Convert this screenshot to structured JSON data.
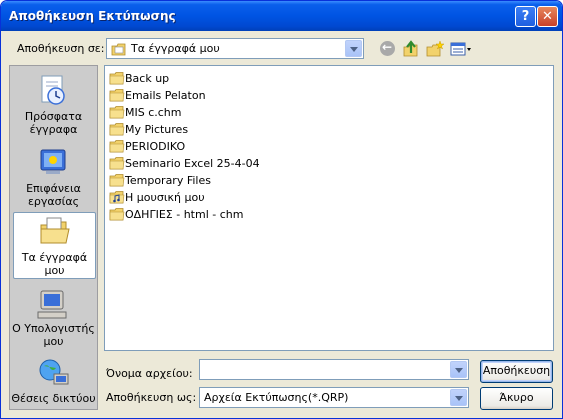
{
  "window": {
    "title": "Αποθήκευση Εκτύπωσης"
  },
  "titlebar": {
    "help_label": "?",
    "close_label": "✕"
  },
  "look_in": {
    "label": "Αποθήκευση σε:",
    "value": "Τα έγγραφά μου"
  },
  "toolbar": {
    "icons": [
      "back-icon",
      "up-folder-icon",
      "new-folder-icon",
      "view-menu-icon"
    ]
  },
  "places": [
    {
      "label": "Πρόσφατα έγγραφα",
      "icon": "recent-documents-icon"
    },
    {
      "label": "Επιφάνεια εργασίας",
      "icon": "desktop-icon"
    },
    {
      "label": "Τα έγγραφά μου",
      "icon": "my-documents-icon",
      "selected": true
    },
    {
      "label": "Ο Υπολογιστής μου",
      "icon": "my-computer-icon"
    },
    {
      "label": "Θέσεις δικτύου",
      "icon": "network-places-icon"
    }
  ],
  "files": [
    {
      "name": "Back up",
      "icon": "folder-icon"
    },
    {
      "name": "Emails Pelaton",
      "icon": "folder-icon"
    },
    {
      "name": "MIS c.chm",
      "icon": "folder-icon"
    },
    {
      "name": "My Pictures",
      "icon": "folder-icon"
    },
    {
      "name": "PERIODIKO",
      "icon": "folder-icon"
    },
    {
      "name": "Seminario Excel 25-4-04",
      "icon": "folder-icon"
    },
    {
      "name": "Temporary Files",
      "icon": "folder-icon"
    },
    {
      "name": "Η μουσική μου",
      "icon": "music-folder-icon"
    },
    {
      "name": "ΟΔΗΓΙΕΣ - html - chm",
      "icon": "folder-icon"
    }
  ],
  "filename": {
    "label": "Όνομα αρχείου:",
    "value": ""
  },
  "file_type": {
    "label": "Αποθήκευση ως:",
    "value": "Αρχεία Εκτύπωσης(*.QRP)"
  },
  "buttons": {
    "save": "Αποθήκευση",
    "cancel": "Άκυρο"
  },
  "colors": {
    "titlebar": "#0054E3",
    "dialog_bg": "#ECE9D8",
    "places_bg": "#CCCCCC",
    "folder": "#F2D26B"
  }
}
